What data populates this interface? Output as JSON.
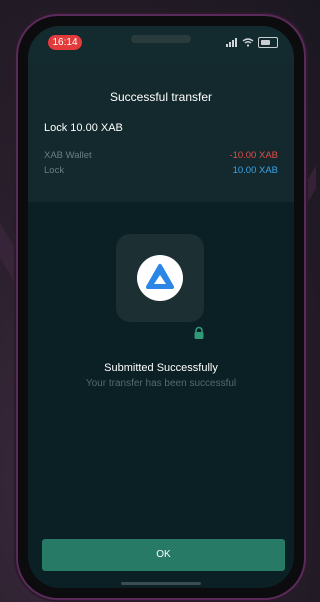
{
  "status_bar": {
    "time": "16:14"
  },
  "header": {
    "title": "Successful transfer",
    "lock_line": "Lock 10.00 XAB",
    "rows": [
      {
        "label": "XAB Wallet",
        "amount": "-10.00 XAB"
      },
      {
        "label": "Lock",
        "amount": "10.00 XAB"
      }
    ]
  },
  "message": {
    "title": "Submitted Successfully",
    "subtitle": "Your transfer has been successful"
  },
  "actions": {
    "ok_label": "OK"
  },
  "colors": {
    "negative": "#e24c4c",
    "positive": "#3aa3e8",
    "accent_button": "#277a66",
    "time_pill": "#e23b3b"
  },
  "icons": {
    "logo": "blue-triangle-logo-icon",
    "lock": "padlock-icon"
  }
}
